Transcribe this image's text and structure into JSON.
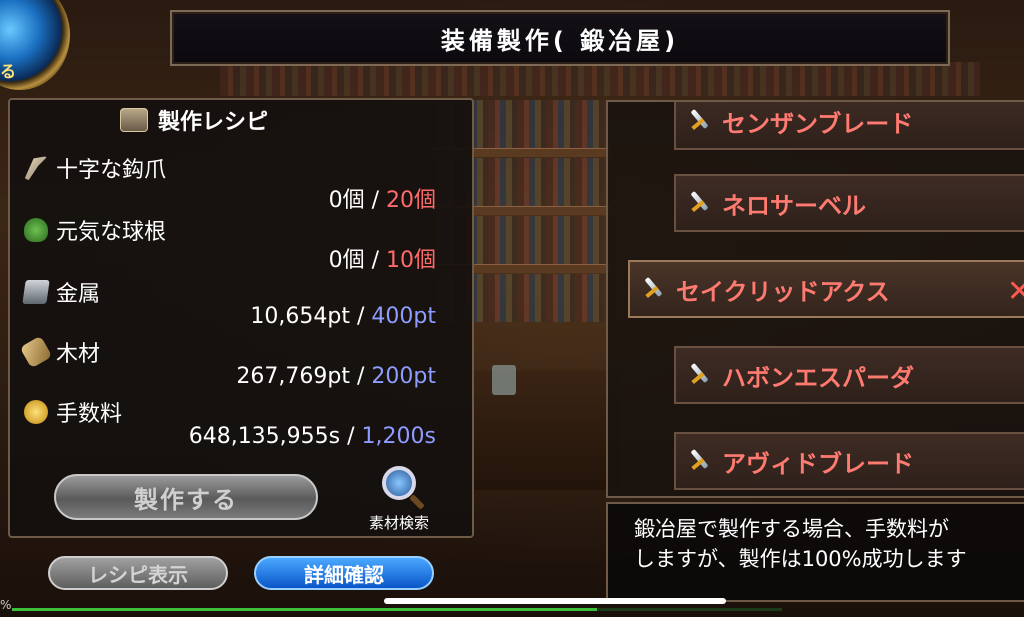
{
  "title": "装備製作(  鍛冶屋)",
  "orb_label": "る",
  "recipe": {
    "heading": "製作レシピ",
    "items": [
      {
        "name": "十字な鈎爪",
        "icon": "claw-icon",
        "have": "0個",
        "sep": "/",
        "need": "20個",
        "need_color": "red"
      },
      {
        "name": "元気な球根",
        "icon": "bulb-icon",
        "have": "0個",
        "sep": "/",
        "need": "10個",
        "need_color": "red"
      },
      {
        "name": "金属",
        "icon": "metal-icon",
        "have": "10,654pt",
        "sep": "/",
        "need": "400pt",
        "need_color": "blue"
      },
      {
        "name": "木材",
        "icon": "wood-icon",
        "have": "267,769pt",
        "sep": "/",
        "need": "200pt",
        "need_color": "blue"
      },
      {
        "name": "手数料",
        "icon": "coin-icon",
        "have": "648,135,955s",
        "sep": "/",
        "need": "1,200s",
        "need_color": "blue"
      }
    ],
    "make_button": "製作する",
    "search_label": "素材検索"
  },
  "buttons": {
    "recipe_view": "レシピ表示",
    "detail": "詳細確認"
  },
  "weapons": [
    {
      "name": "センザンブレード",
      "selected": false
    },
    {
      "name": "ネロサーベル",
      "selected": false
    },
    {
      "name": "セイクリッドアクス",
      "selected": true
    },
    {
      "name": "ハボンエスパーダ",
      "selected": false
    },
    {
      "name": "アヴィドブレード",
      "selected": false
    }
  ],
  "close_glyph": "✕",
  "info": {
    "line1": "鍛冶屋で製作する場合、手数料が",
    "line2": "しますが、製作は100%成功します"
  },
  "percent_label": "%",
  "progress": 0.76
}
